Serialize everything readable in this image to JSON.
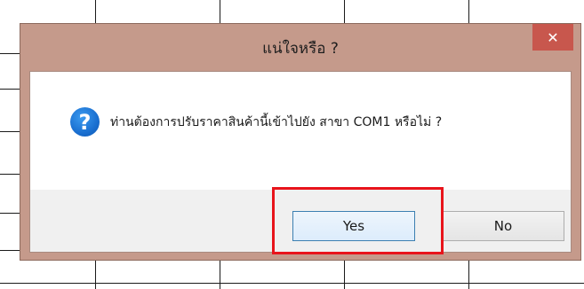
{
  "dialog": {
    "title": "แน่ใจหรือ ?",
    "close_label": "✕",
    "message": "ท่านต้องการปรับราคาสินค้านี้เข้าไปยัง สาขา COM1 หรือไม่ ?",
    "icon": "question-icon",
    "icon_glyph": "?",
    "buttons": {
      "yes": "Yes",
      "no": "No"
    }
  },
  "colors": {
    "frame": "#c59a8b",
    "close_button": "#c8574d",
    "highlight": "#e8141b",
    "icon": "#1a6fd0"
  }
}
